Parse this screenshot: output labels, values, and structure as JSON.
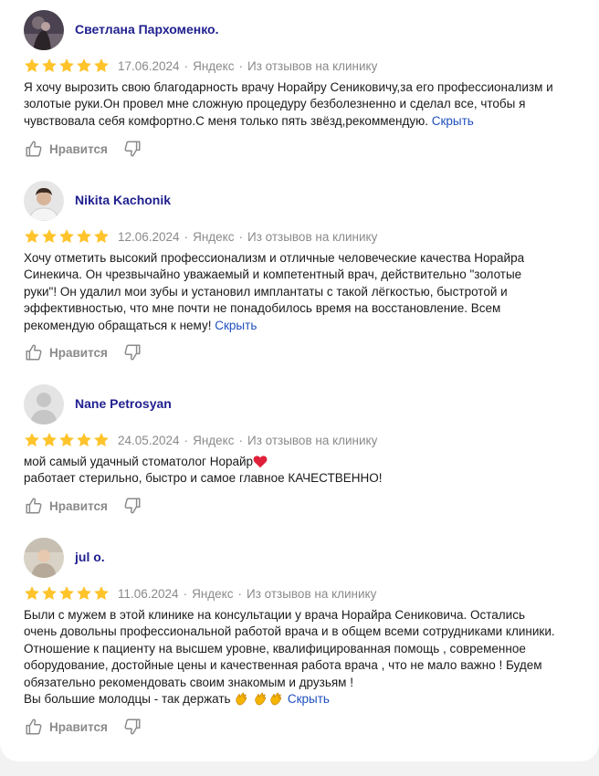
{
  "colors": {
    "author": "#1f1f8f",
    "star": "#ffc32b",
    "link": "#1f4fbf",
    "muted": "#8a8a8a",
    "page_bg": "#f2f2f2"
  },
  "reviews": [
    {
      "author": "Светлана Пархоменко.",
      "avatar": "photo-avatar",
      "rating": 5,
      "date": "17.06.2024",
      "source": "Яндекс",
      "origin": "Из отзывов на клинику",
      "lines": [
        "Я хочу вырозить свою благодарность врачу Норайру Сениковичу,за его профессионализм и",
        "золотые руки.Он провел мне сложную процедуру безболезненно и сделал все, чтобы я",
        "чувствовала себя комфортно.С меня только пять звёзд,рекоммендую."
      ],
      "collapse_label": "Скрыть",
      "like_label": "Нравится"
    },
    {
      "author": "Nikita Kachonik",
      "avatar": "photo-avatar",
      "rating": 5,
      "date": "12.06.2024",
      "source": "Яндекс",
      "origin": "Из отзывов на клинику",
      "lines": [
        "Хочу отметить высокий профессионализм и отличные человеческие качества Норайра",
        "Синекича. Он чрезвычайно уважаемый и компетентный врач, действительно \"золотые",
        "руки\"! Он удалил мои зубы и установил имплантаты с такой лёгкостью, быстротой и",
        "эффективностью, что мне почти не понадобилось время на восстановление. Всем",
        "рекомендую обращаться к нему!"
      ],
      "collapse_label": "Скрыть",
      "like_label": "Нравится"
    },
    {
      "author": "Nane Petrosyan",
      "avatar": "default-avatar",
      "rating": 5,
      "date": "24.05.2024",
      "source": "Яндекс",
      "origin": "Из отзывов на клинику",
      "lines": [
        "мой самый удачный стоматолог Норайр",
        "работает стерильно, быстро и самое главное КАЧЕСТВЕННО!"
      ],
      "line1_emoji": "heart-emoji",
      "like_label": "Нравится"
    },
    {
      "author": "jul o.",
      "avatar": "photo-avatar",
      "rating": 5,
      "date": "11.06.2024",
      "source": "Яндекс",
      "origin": "Из отзывов на клинику",
      "lines": [
        "Были с мужем в этой клинике на консультации у врача Норайра Сениковича. Остались",
        "очень довольны профессиональной работой врача и в общем всеми сотрудниками клиники.",
        "Отношение к пациенту на высшем уровне, квалифицированная помощь , современное",
        "оборудование, достойные цены и качественная работа врача , что не мало важно ! Будем",
        "обязательно рекомендовать своим знакомым и друзьям !",
        "Вы большие молодцы - так держать"
      ],
      "last_line_emoji": "clapping-hands-emoji",
      "collapse_label": "Скрыть",
      "like_label": "Нравится"
    }
  ]
}
